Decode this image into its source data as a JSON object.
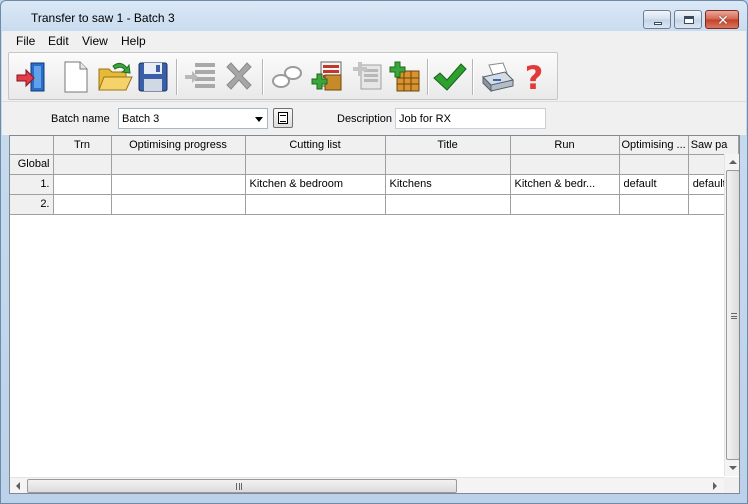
{
  "window": {
    "title": "Transfer to saw 1 - Batch 3"
  },
  "menu": [
    "File",
    "Edit",
    "View",
    "Help"
  ],
  "toolbar": [
    {
      "icon": "exit-door-icon"
    },
    {
      "icon": "new-document-icon"
    },
    {
      "icon": "open-folder-icon"
    },
    {
      "icon": "save-disk-icon"
    },
    {
      "icon": "insert-row-icon"
    },
    {
      "icon": "delete-icon"
    },
    {
      "icon": "link-icon"
    },
    {
      "icon": "add-cutting-list-icon"
    },
    {
      "icon": "edit-cutting-list-icon"
    },
    {
      "icon": "add-board-icon"
    },
    {
      "icon": "check-icon"
    },
    {
      "icon": "print-icon"
    },
    {
      "icon": "help-icon"
    }
  ],
  "form": {
    "batch_name_label": "Batch name",
    "batch_name_value": "Batch 3",
    "description_label": "Description",
    "description_value": "Job for RX"
  },
  "grid": {
    "columns": [
      "",
      "Trn",
      "Optimising progress",
      "Cutting list",
      "Title",
      "Run",
      "Optimising ...",
      "Saw pa"
    ],
    "rows": [
      [
        "Global",
        "",
        "",
        "",
        "",
        "",
        "",
        ""
      ],
      [
        "1.",
        "",
        "",
        "Kitchen & bedroom",
        "Kitchens",
        "Kitchen & bedr...",
        "default",
        "default"
      ],
      [
        "2.",
        "",
        "",
        "",
        "",
        "",
        "",
        ""
      ]
    ]
  },
  "colors": {
    "accent": "#2a6cc7",
    "close": "#c1402a",
    "check": "#2ea02e",
    "help": "#e23a3a"
  }
}
